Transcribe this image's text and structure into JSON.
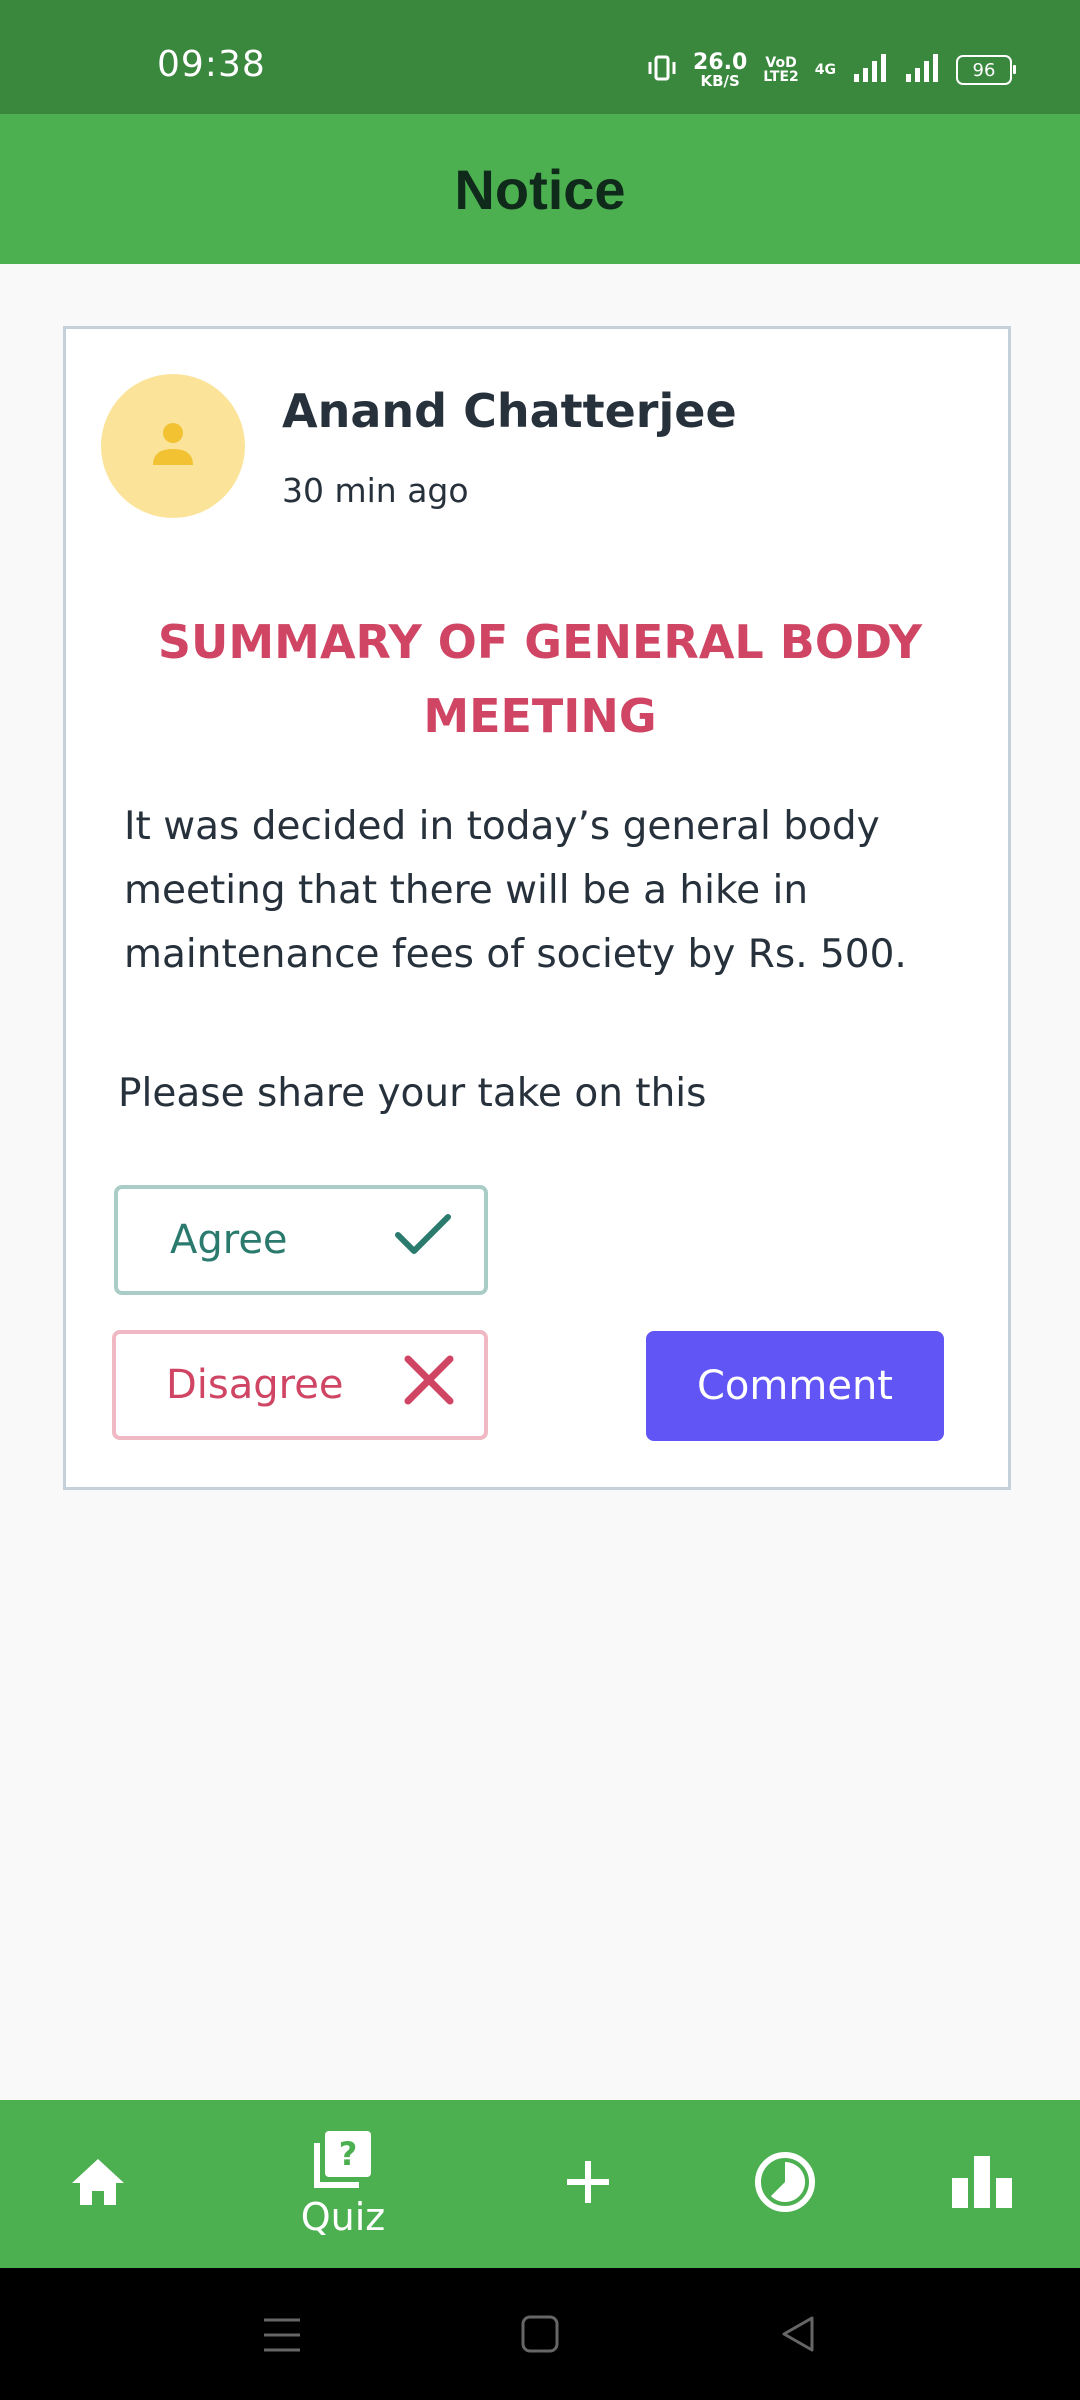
{
  "status_bar": {
    "time": "09:38",
    "net_speed_value": "26.0",
    "net_speed_unit": "KB/S",
    "volte_top": "VoD",
    "volte_bottom": "LTE2",
    "network_type": "4G",
    "battery": "96"
  },
  "app_bar": {
    "title": "Notice"
  },
  "notice": {
    "author": "Anand Chatterjee",
    "time_ago": "30 min ago",
    "title": "SUMMARY OF GENERAL BODY MEETING",
    "body": "It was decided in today’s general body meeting that there will be a hike in maintenance fees of society by Rs. 500.",
    "prompt": "Please share your take on this",
    "agree_label": "Agree",
    "disagree_label": "Disagree",
    "comment_label": "Comment"
  },
  "bottom_nav": {
    "items": [
      {
        "icon": "home-icon",
        "label": ""
      },
      {
        "icon": "quiz-icon",
        "label": "Quiz"
      },
      {
        "icon": "plus-icon",
        "label": ""
      },
      {
        "icon": "pie-chart-icon",
        "label": ""
      },
      {
        "icon": "bar-chart-icon",
        "label": ""
      }
    ]
  },
  "colors": {
    "status_bar": "#3a873e",
    "app_bar": "#4caf50",
    "title_red": "#cf4563",
    "agree_teal": "#2a7a6e",
    "comment_purple": "#6155f5",
    "avatar_bg": "#fbe49a"
  }
}
